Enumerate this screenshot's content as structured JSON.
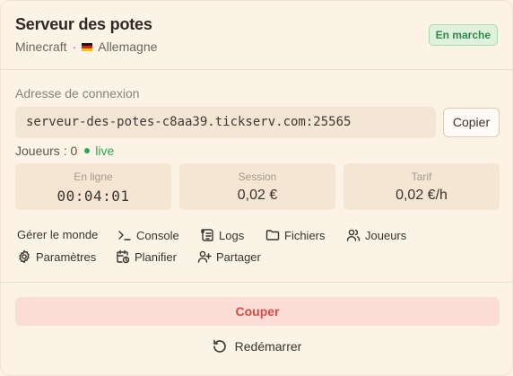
{
  "server": {
    "name": "Serveur des potes",
    "game": "Minecraft",
    "separator": "·",
    "flag_icon": "germany-flag",
    "location": "Allemagne",
    "status": "En marche"
  },
  "connection": {
    "label": "Adresse de connexion",
    "address": "serveur-des-potes-c8aa39.tickserv.com:25565",
    "copy_label": "Copier"
  },
  "players": {
    "label": "Joueurs : 0",
    "live_label": "live"
  },
  "stats": [
    {
      "label": "En ligne",
      "value": "00:04:01"
    },
    {
      "label": "Session",
      "value": "0,02 €"
    },
    {
      "label": "Tarif",
      "value": "0,02 €/h"
    }
  ],
  "actions": [
    {
      "label": "Gérer le monde",
      "icon": "none"
    },
    {
      "label": "Console",
      "icon": "terminal-icon"
    },
    {
      "label": "Logs",
      "icon": "logs-icon"
    },
    {
      "label": "Fichiers",
      "icon": "folder-icon"
    },
    {
      "label": "Joueurs",
      "icon": "users-icon"
    },
    {
      "label": "Paramètres",
      "icon": "gear-icon"
    },
    {
      "label": "Planifier",
      "icon": "calendar-clock-icon"
    },
    {
      "label": "Partager",
      "icon": "user-plus-icon"
    }
  ],
  "buttons": {
    "cut": "Couper",
    "restart": "Redémarrer"
  },
  "colors": {
    "status_green": "#2e8b46",
    "danger_red": "#d94c43",
    "background": "#fcf2e6"
  }
}
